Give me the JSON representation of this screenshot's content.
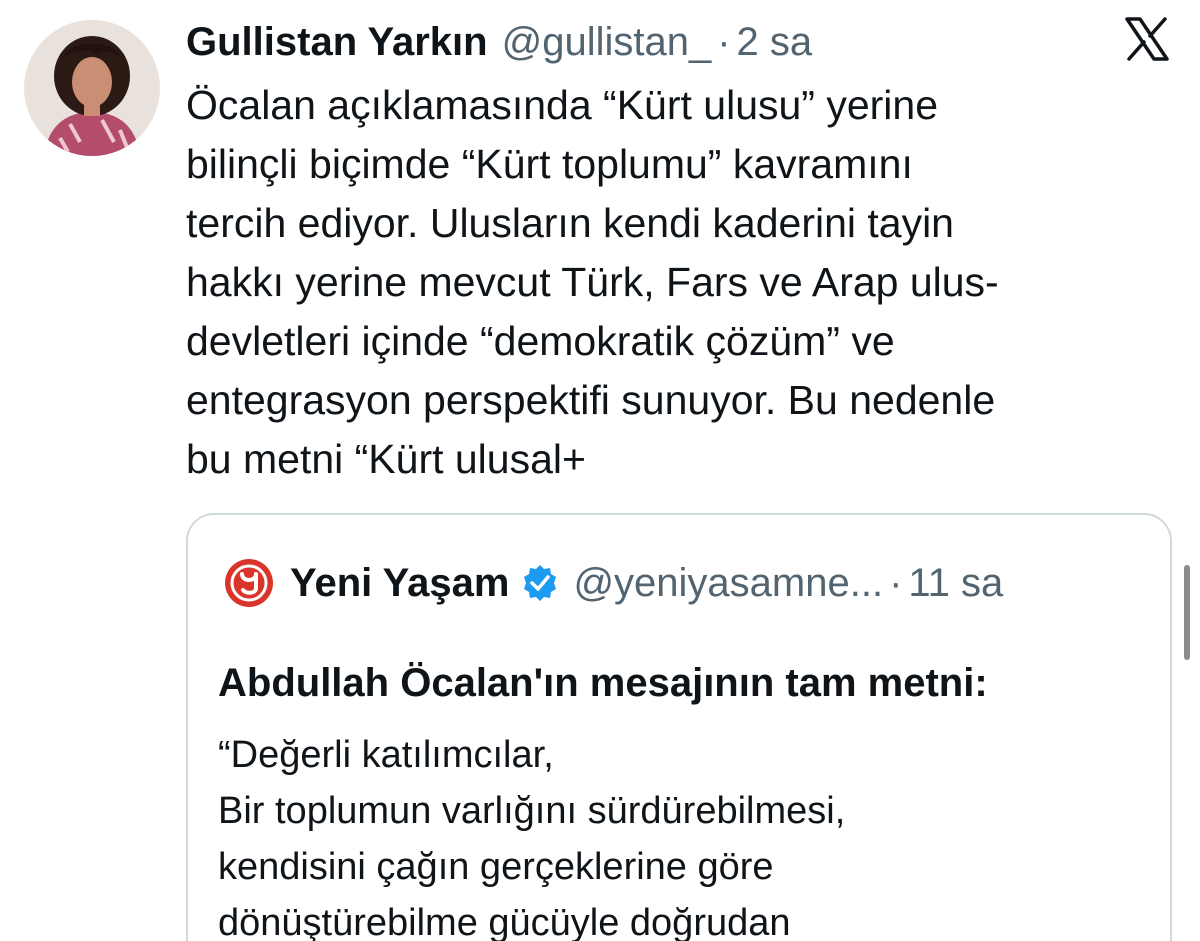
{
  "tweet": {
    "author_name": "Gullistan Yarkın",
    "author_handle": "@gullistan_",
    "separator": "·",
    "time": "2 sa",
    "text_lines": [
      "Öcalan açıklamasında “Kürt ulusu” yerine",
      "bilinçli biçimde “Kürt toplumu” kavramını",
      "tercih ediyor. Ulusların kendi kaderini tayin",
      "hakkı yerine mevcut Türk, Fars ve Arap ulus-",
      "devletleri içinde “demokratik çözüm” ve",
      "entegrasyon perspektifi sunuyor. Bu nedenle",
      "bu metni “Kürt ulusal+"
    ]
  },
  "quoted_tweet": {
    "author_name": "Yeni Yaşam",
    "author_handle": "@yeniyasamne...",
    "separator": "·",
    "time": "11 sa",
    "title": "Abdullah Öcalan'ın mesajının tam metni:",
    "body_lines": [
      "“Değerli katılımcılar,",
      "Bir toplumun varlığını sürdürebilmesi,",
      "kendisini çağın gerçeklerine göre",
      "dönüştürebilme gücüyle doğrudan"
    ]
  },
  "icons": {
    "avatar": "profile-photo-avatar",
    "platform_logo": "x-logo-icon",
    "quote_logo": "yeni-yasam-logo-icon",
    "verified": "verified-badge-icon"
  },
  "colors": {
    "text_primary": "#0f1419",
    "text_secondary": "#536471",
    "border": "#cfd9de",
    "verified_blue": "#1d9bf0",
    "yeni_yasam_red": "#d9352b"
  }
}
